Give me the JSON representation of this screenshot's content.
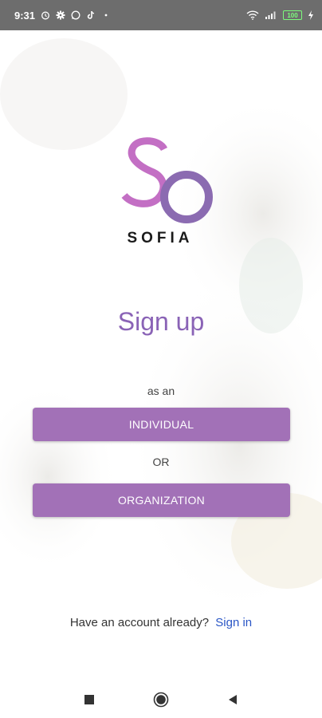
{
  "status_bar": {
    "time": "9:31",
    "left_icons": [
      "alarm-icon",
      "gear-icon",
      "whatsapp-icon",
      "tiktok-icon",
      "dot-icon"
    ],
    "right_icons": [
      "wifi-icon",
      "signal-icon",
      "battery-icon",
      "charging-icon"
    ],
    "battery_level": "100",
    "colors": {
      "background": "#6d6d6d",
      "battery": "#7cfc7c"
    }
  },
  "brand": {
    "logo_text": "SO",
    "name": "SOFIA",
    "colors": {
      "s_letter": "#c36fc4",
      "o_letter": "#8b6bb1"
    }
  },
  "main": {
    "title": "Sign up",
    "subtitle": "as an",
    "individual_label": "INDIVIDUAL",
    "separator": "OR",
    "organization_label": "ORGANIZATION"
  },
  "footer": {
    "prompt": "Have an account already?",
    "link_label": "Sign in"
  },
  "nav_bar": {
    "items": [
      "recent-apps-icon",
      "home-icon",
      "back-icon"
    ]
  },
  "colors": {
    "accent": "#a271b7",
    "title": "#8a63b6",
    "link": "#2a56c6"
  }
}
